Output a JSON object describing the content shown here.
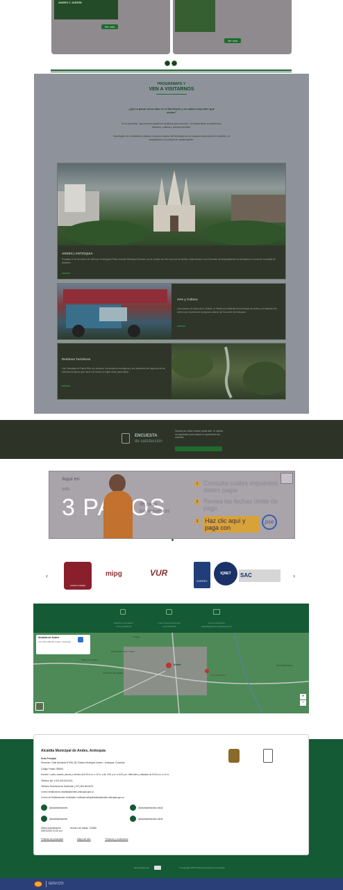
{
  "top_cards": {
    "left_button": "Ver más",
    "right_button": "Ver más",
    "left_caption": "ANDES Y JARDÍN"
  },
  "visit": {
    "eyebrow": "PROGRÁMATE Y",
    "title": "VEN A VISITARNOS",
    "question": "¿Qué a pasar unos días en el Municipio y no sabes muy bien qué visitar?",
    "paragraph1": "En el presente, hay muchos atractivos turísticos para conocer. La ciudad tiene un patrimonio histórico, cultural y natural increíble.",
    "paragraph2": "Sumérgete en el ambiente cultural, el acervo urbano del Municipio es un espacio sensorial de la tradición, la arquitectura y la cultura de nuestra gente.",
    "destinations": [
      {
        "title": "ANDES | ANTIOQUIA",
        "text": "Fundado el 13 de marzo de 1852 por el abogado Pedro Antonio Restrepo Escobar con el nombre de San Juan de los Andes, está ubicado en el Suroeste del departamento de Antioquia a 3 horas de la ciudad de Medellín."
      },
      {
        "title": "Arte y Cultura",
        "text": "Los museos, la Casa de la Cultura, el Patrimonio Material del municipio de Andes y la tradición del arriero son muestra de la riqueza cultural del Suroeste de Antioquia."
      },
      {
        "title": "Destinos Turísticos",
        "text": "Las Cascadas de Santa Rita, los charcos, los senderos ecológicos y los miradores son algunos de los destinos turísticos que hacen de Andes un lugar único para visitar."
      }
    ]
  },
  "survey": {
    "line1": "ENCUESTA",
    "line2": "de satisfacción",
    "text": "Gracias por visitar nuestro portal web. Tu opinión es importante para mejorar tu experiencia con nosotros."
  },
  "banner": {
    "aqui": "Aquí en",
    "solo": "solo",
    "pasos": "3 PASOS",
    "de_pago": "de pago",
    "tus_impuestos": "tus impuestos",
    "step1": "Consulta cuáles impuestos debes pagar",
    "step2": "Revisa las fechas límite de pago",
    "step3": "Haz clic aquí y paga con",
    "pse": "pse",
    "n1": "1",
    "n2": "2",
    "n3": "3"
  },
  "logos": [
    "Gobierno Digital",
    "mipg",
    "VUR",
    "ICONTEC",
    "IQNET",
    "SAC"
  ],
  "contact": {
    "phone_label": "Teléfono conmutador:",
    "phone_value": "(+57) 4 8414101",
    "line_label": "Línea Única de Atención:",
    "line_value": "(+57) 8414101",
    "email_label": "Correo electrónico:",
    "email_value": "alcaldia@andes-antioquia.gov.co"
  },
  "map": {
    "place_title": "Alcaldía de Andes",
    "place_sub": "Cra. 50 # 49A-36, Andes, Antioquia",
    "labels": [
      "Colegio",
      "Andes",
      "Parque San Pedro Claver",
      "Barrio Los Andes",
      "CAMICOL DE ANDES",
      "Andes Antioquia",
      "Finca Maravillosa"
    ]
  },
  "footer": {
    "title": "Alcaldía Municipal de Andes, Antioquia",
    "sede": "Sede Principal",
    "address": "Dirección: Calle Arboleda N°49A-36 | Palacio Municipal, Andes – Antioquia, Colombia",
    "postal": "Código Postal: 055810",
    "hours": "Horario: Lunes, martes, jueves y viernes de 8:00 a.m. a 12 m. y de 2:00 p.m. a 6:00 p.m. Miércoles y sábados de 8:00 a.m. a 12 m.",
    "phone": "Teléfono fijo: (+57) 604 8414101",
    "secretary": "Teléfono Secretaría de Hacienda: (+57) 604 8414102",
    "email": "Correo Institucional: alcaldia@andes-antioquia.gov.co",
    "notifications": "Correo de Notificaciones Judiciales: notificacionesjudiciales@andes-antioquia.gov.co",
    "social": [
      "@alcaldiadeandes",
      "@alcaldiadeandes.oficial",
      "@alcaldiadeandes",
      "@alcaldiadeandes.oficial"
    ],
    "stats": [
      "Última Actualización: 03/04/2025 10:05 a.m.",
      "Número de visitas: 123456"
    ],
    "links": [
      "Políticas de privacidad",
      "Mapa del sitio",
      "Términos y condiciones"
    ],
    "powered": "Desarrollado por",
    "copyright": "© Copyright 2025 Todos los derechos reservados"
  },
  "govco": "GOV.CO",
  "colors": {
    "primary_green": "#145a35",
    "gov_blue": "#2a3f78"
  }
}
